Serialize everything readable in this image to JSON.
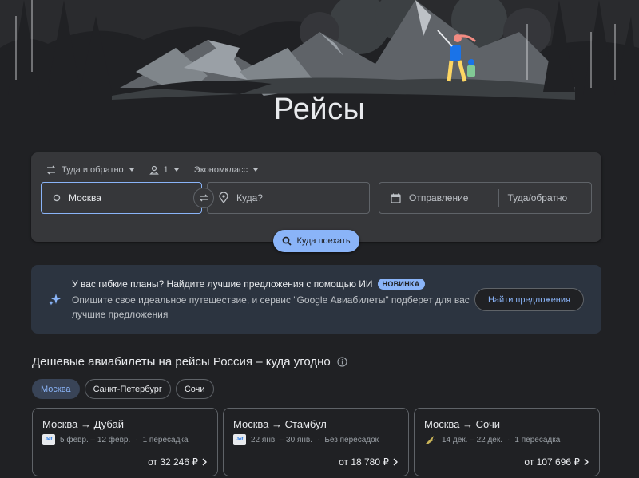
{
  "page": {
    "title": "Рейсы"
  },
  "search": {
    "trip_type": "Туда и обратно",
    "passengers": "1",
    "cabin_class": "Экономкласс",
    "origin_value": "Москва",
    "destination_placeholder": "Куда?",
    "departure_placeholder": "Отправление",
    "return_placeholder": "Туда/обратно",
    "explore_label": "Куда поехать"
  },
  "ai_banner": {
    "title": "У вас гибкие планы? Найдите лучшие предложения с помощью ИИ",
    "badge": "НОВИНКА",
    "description": "Опишите свое идеальное путешествие, и сервис \"Google Авиабилеты\" подберет для вас лучшие предложения",
    "button_label": "Найти предложения"
  },
  "section": {
    "title": "Дешевые авиабилеты на рейсы Россия – куда угодно",
    "chips": [
      {
        "label": "Москва",
        "active": true
      },
      {
        "label": "Санкт-Петербург",
        "active": false
      },
      {
        "label": "Сочи",
        "active": false
      }
    ]
  },
  "cards": [
    {
      "from": "Москва",
      "to": "Дубай",
      "dates": "5 февр. – 12 февр.",
      "stops": "1 пересадка",
      "price": "от 32 246 ₽",
      "airline_logo": "airline-logo-icon"
    },
    {
      "from": "Москва",
      "to": "Стамбул",
      "dates": "22 янв. – 30 янв.",
      "stops": "Без пересадок",
      "price": "от 18 780 ₽",
      "airline_logo": "airline-logo-icon"
    },
    {
      "from": "Москва",
      "to": "Сочи",
      "dates": "14 дек. – 22 дек.",
      "stops": "1 пересадка",
      "price": "от 107 696 ₽",
      "airline_logo": "airline-logo-icon"
    }
  ],
  "colors": {
    "accent": "#8ab4f8",
    "background": "#202124",
    "panel": "#36373a",
    "banner": "#2c3440"
  }
}
